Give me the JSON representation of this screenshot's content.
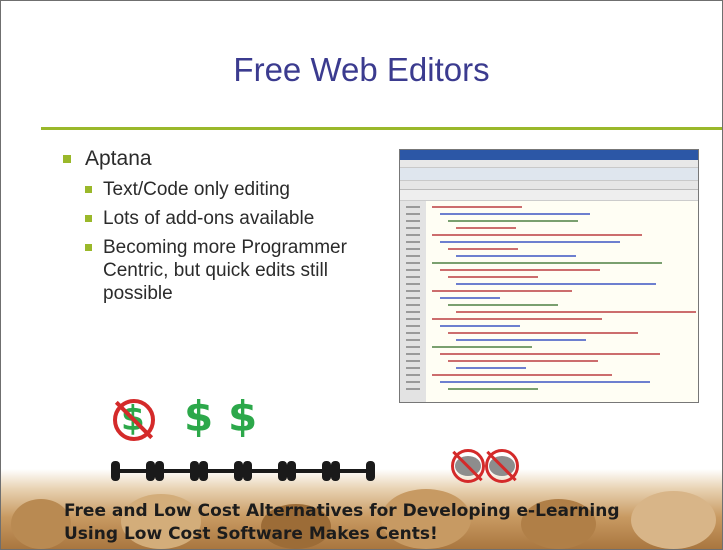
{
  "slide": {
    "title": "Free Web Editors",
    "bullet": "Aptana",
    "sub_bullets": [
      "Text/Code only editing",
      "Lots of add-ons available",
      "Becoming more Programmer Centric, but quick edits still possible"
    ],
    "footer_line1": "Free and Low Cost Alternatives for Developing e-Learning",
    "footer_line2": "Using Low Cost Software Makes Cents!"
  },
  "icons": {
    "dollar_glyph": "$",
    "no_dollar": "no-dollar-icon",
    "dollar": "dollar-icon",
    "chain": "dumbbell-chain-icon",
    "no_brain": "no-brain-icon"
  },
  "colors": {
    "title": "#3b3b8f",
    "accent": "#9ab82a",
    "dollar": "#2ca84a",
    "prohibit": "#d42a2a"
  }
}
